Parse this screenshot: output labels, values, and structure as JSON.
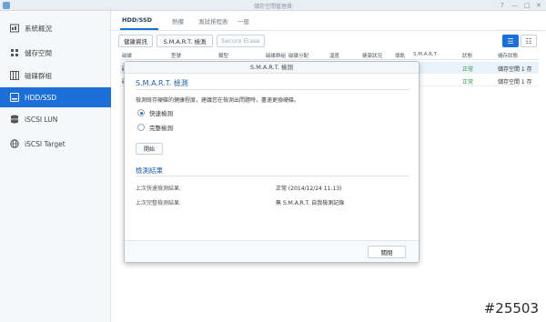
{
  "window": {
    "title": "儲存空間管理員",
    "controls": [
      "?",
      "—",
      "□",
      "✕"
    ]
  },
  "sidebar": {
    "items": [
      {
        "label": "系統概況",
        "icon": "home-icon",
        "active": false
      },
      {
        "label": "儲存空間",
        "icon": "storage-icon",
        "active": false
      },
      {
        "label": "磁碟群組",
        "icon": "disk-group-icon",
        "active": false
      },
      {
        "label": "HDD/SSD",
        "icon": "hdd-icon",
        "active": true
      },
      {
        "label": "iSCSI LUN",
        "icon": "database-icon",
        "active": false
      },
      {
        "label": "iSCSI Target",
        "icon": "globe-icon",
        "active": false
      }
    ]
  },
  "tabs": [
    {
      "label": "HDD/SSD",
      "active": true
    },
    {
      "label": "熱備",
      "active": false
    },
    {
      "label": "測試排程表",
      "active": false
    },
    {
      "label": "一般",
      "active": false
    }
  ],
  "toolbar": {
    "health_info": "健康資訊",
    "smart_test": "S.M.A.R.T. 檢測",
    "secure_erase": "Secure Erase"
  },
  "table": {
    "columns": [
      "磁碟",
      "型號",
      "類型",
      "磁碟群組",
      "磁碟分配",
      "溫度",
      "健康狀況",
      "壞軌",
      "S.M.A.R.T.",
      "狀態",
      "儲存狀態"
    ],
    "rows": [
      {
        "c0": "磁",
        "status": "正常",
        "alloc": "儲存空間 1 存"
      },
      {
        "c0": "磁",
        "status": "正常",
        "alloc": "儲存空間 1 存"
      }
    ]
  },
  "dialog": {
    "title": "S.M.A.R.T. 檢測",
    "heading": "S.M.A.R.T. 檢測",
    "description": "檢測既存硬碟的健康程度，建議您在檢測出問題時，盡速更換硬碟。",
    "options": [
      {
        "label": "快速檢測",
        "selected": true
      },
      {
        "label": "完整檢測",
        "selected": false
      }
    ],
    "start_button": "開始",
    "results_heading": "檢測結果",
    "results": [
      {
        "label": "上次快速檢測結果:",
        "value": "正常 (2014/12/24 11:13)"
      },
      {
        "label": "上次完整檢測結果:",
        "value": "無 S.M.A.R.T. 自我檢測記錄"
      }
    ],
    "close_button": "關閉"
  },
  "watermark": "#25503",
  "colors": {
    "accent": "#1b6fd6",
    "ok": "#2f9e3f",
    "heading": "#1f5fa8"
  }
}
